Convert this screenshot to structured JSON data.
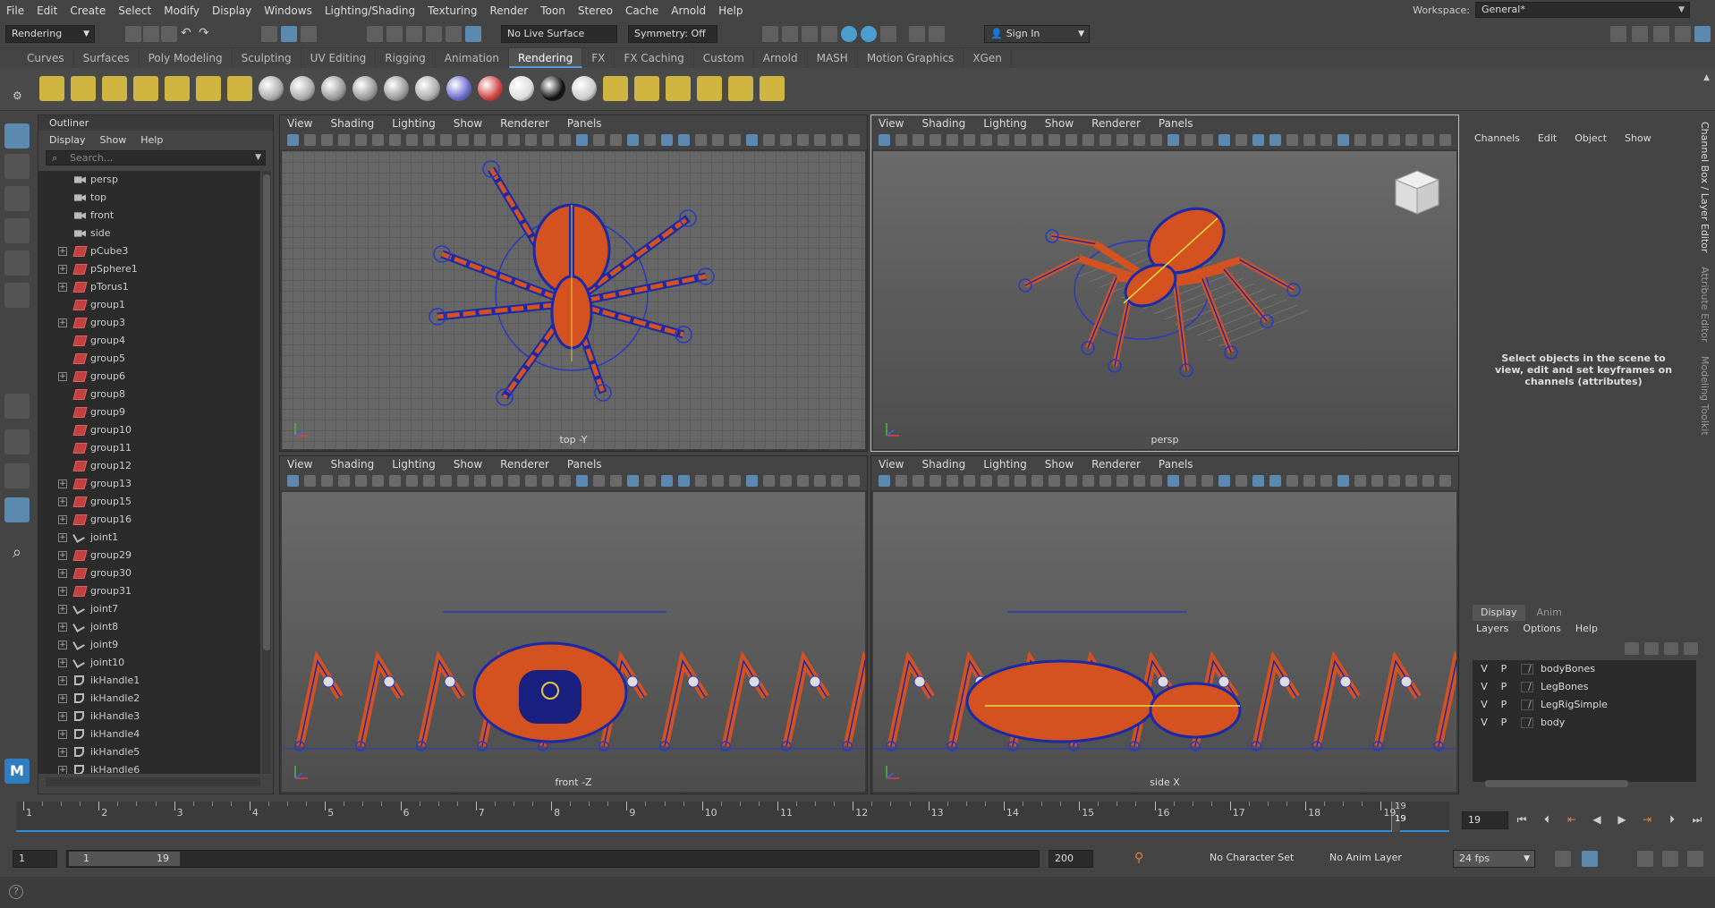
{
  "menubar": {
    "items": [
      "File",
      "Edit",
      "Create",
      "Select",
      "Modify",
      "Display",
      "Windows",
      "Lighting/Shading",
      "Texturing",
      "Render",
      "Toon",
      "Stereo",
      "Cache",
      "Arnold",
      "Help"
    ],
    "workspace_label": "Workspace:",
    "workspace_value": "General*"
  },
  "status": {
    "menuset": "Rendering",
    "live_surface": "No Live Surface",
    "symmetry": "Symmetry: Off",
    "sign_in": "Sign In"
  },
  "shelf": {
    "tabs": [
      "Curves",
      "Surfaces",
      "Poly Modeling",
      "Sculpting",
      "UV Editing",
      "Rigging",
      "Animation",
      "Rendering",
      "FX",
      "FX Caching",
      "Custom",
      "Arnold",
      "MASH",
      "Motion Graphics",
      "XGen"
    ],
    "active": "Rendering"
  },
  "outliner": {
    "title": "Outliner",
    "menu": [
      "Display",
      "Show",
      "Help"
    ],
    "search_placeholder": "Search...",
    "items": [
      {
        "name": "persp",
        "type": "cam",
        "exp": false
      },
      {
        "name": "top",
        "type": "cam",
        "exp": false
      },
      {
        "name": "front",
        "type": "cam",
        "exp": false
      },
      {
        "name": "side",
        "type": "cam",
        "exp": false
      },
      {
        "name": "pCube3",
        "type": "grp",
        "exp": true
      },
      {
        "name": "pSphere1",
        "type": "grp",
        "exp": true
      },
      {
        "name": "pTorus1",
        "type": "grp",
        "exp": true
      },
      {
        "name": "group1",
        "type": "grp",
        "exp": false
      },
      {
        "name": "group3",
        "type": "grp",
        "exp": true
      },
      {
        "name": "group4",
        "type": "grp",
        "exp": false
      },
      {
        "name": "group5",
        "type": "grp",
        "exp": false
      },
      {
        "name": "group6",
        "type": "grp",
        "exp": true
      },
      {
        "name": "group8",
        "type": "grp",
        "exp": false
      },
      {
        "name": "group9",
        "type": "grp",
        "exp": false
      },
      {
        "name": "group10",
        "type": "grp",
        "exp": false
      },
      {
        "name": "group11",
        "type": "grp",
        "exp": false
      },
      {
        "name": "group12",
        "type": "grp",
        "exp": false
      },
      {
        "name": "group13",
        "type": "grp",
        "exp": true
      },
      {
        "name": "group15",
        "type": "grp",
        "exp": true
      },
      {
        "name": "group16",
        "type": "grp",
        "exp": true
      },
      {
        "name": "joint1",
        "type": "jnt",
        "exp": true
      },
      {
        "name": "group29",
        "type": "grp",
        "exp": true
      },
      {
        "name": "group30",
        "type": "grp",
        "exp": true
      },
      {
        "name": "group31",
        "type": "grp",
        "exp": true
      },
      {
        "name": "joint7",
        "type": "jnt",
        "exp": true
      },
      {
        "name": "joint8",
        "type": "jnt",
        "exp": true
      },
      {
        "name": "joint9",
        "type": "jnt",
        "exp": true
      },
      {
        "name": "joint10",
        "type": "jnt",
        "exp": true
      },
      {
        "name": "ikHandle1",
        "type": "ik",
        "exp": true
      },
      {
        "name": "ikHandle2",
        "type": "ik",
        "exp": true
      },
      {
        "name": "ikHandle3",
        "type": "ik",
        "exp": true
      },
      {
        "name": "ikHandle4",
        "type": "ik",
        "exp": true
      },
      {
        "name": "ikHandle5",
        "type": "ik",
        "exp": true
      },
      {
        "name": "ikHandle6",
        "type": "ik",
        "exp": true
      }
    ]
  },
  "viewport": {
    "menu": [
      "View",
      "Shading",
      "Lighting",
      "Show",
      "Renderer",
      "Panels"
    ],
    "panels": [
      {
        "caption": "top -Y"
      },
      {
        "caption": "persp"
      },
      {
        "caption": "front -Z"
      },
      {
        "caption": "side X"
      }
    ]
  },
  "channel_box": {
    "menu": [
      "Channels",
      "Edit",
      "Object",
      "Show"
    ],
    "hint": "Select objects in the scene to view, edit and set keyframes on channels (attributes)",
    "side_tabs": [
      "Channel Box / Layer Editor",
      "Attribute Editor",
      "Modeling Toolkit"
    ]
  },
  "layer_editor": {
    "tabs": [
      "Display",
      "Anim"
    ],
    "menu": [
      "Layers",
      "Options",
      "Help"
    ],
    "layers": [
      {
        "v": "V",
        "p": "P",
        "name": "bodyBones"
      },
      {
        "v": "V",
        "p": "P",
        "name": "LegBones"
      },
      {
        "v": "V",
        "p": "P",
        "name": "LegRigSimple"
      },
      {
        "v": "V",
        "p": "P",
        "name": "body"
      }
    ]
  },
  "timeline": {
    "ticks": [
      "1",
      "2",
      "3",
      "4",
      "5",
      "6",
      "7",
      "8",
      "9",
      "10",
      "11",
      "12",
      "13",
      "14",
      "15",
      "16",
      "17",
      "18",
      "19"
    ],
    "playhead_top": "19",
    "playhead_bottom": "19",
    "current_frame": "19"
  },
  "range": {
    "start": "1",
    "inner_start": "1",
    "inner_end": "19",
    "end": "200",
    "character_set": "No Character Set",
    "anim_layer": "No Anim Layer",
    "fps": "24 fps"
  },
  "colors": {
    "accent": "#5b89b0",
    "timeline_line": "#2e8fd6",
    "spider_orange": "#d4521f",
    "spider_blue": "#1b2aa8"
  }
}
